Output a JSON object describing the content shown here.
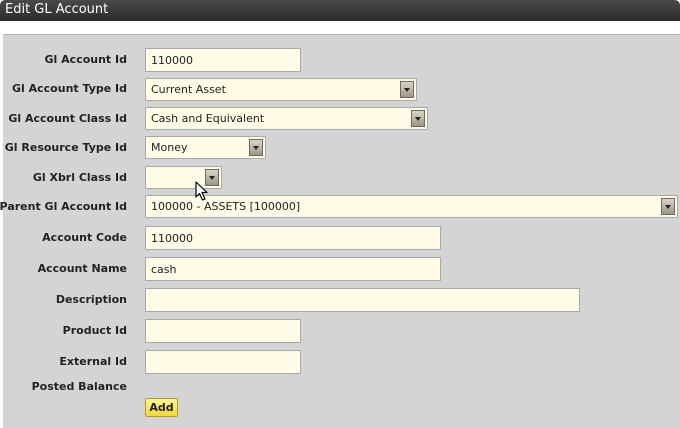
{
  "window": {
    "title": "Edit GL Account"
  },
  "form": {
    "gl_account_id": {
      "label": "Gl Account Id",
      "value": "110000"
    },
    "gl_account_type_id": {
      "label": "Gl Account Type Id",
      "value": "Current Asset"
    },
    "gl_account_class_id": {
      "label": "Gl Account Class Id",
      "value": "Cash and Equivalent"
    },
    "gl_resource_type_id": {
      "label": "Gl Resource Type Id",
      "value": "Money"
    },
    "gl_xbrl_class_id": {
      "label": "Gl Xbrl Class Id",
      "value": ""
    },
    "parent_gl_account_id": {
      "label": "Parent Gl Account Id",
      "value": "100000 - ASSETS [100000]"
    },
    "account_code": {
      "label": "Account Code",
      "value": "110000"
    },
    "account_name": {
      "label": "Account Name",
      "value": "cash"
    },
    "description": {
      "label": "Description",
      "value": ""
    },
    "product_id": {
      "label": "Product Id",
      "value": ""
    },
    "external_id": {
      "label": "External Id",
      "value": ""
    },
    "posted_balance": {
      "label": "Posted Balance"
    },
    "add_button": {
      "label": "Add"
    }
  },
  "icons": {
    "cursor": "mouse-pointer-icon",
    "dropdown": "dropdown-arrow-icon"
  }
}
